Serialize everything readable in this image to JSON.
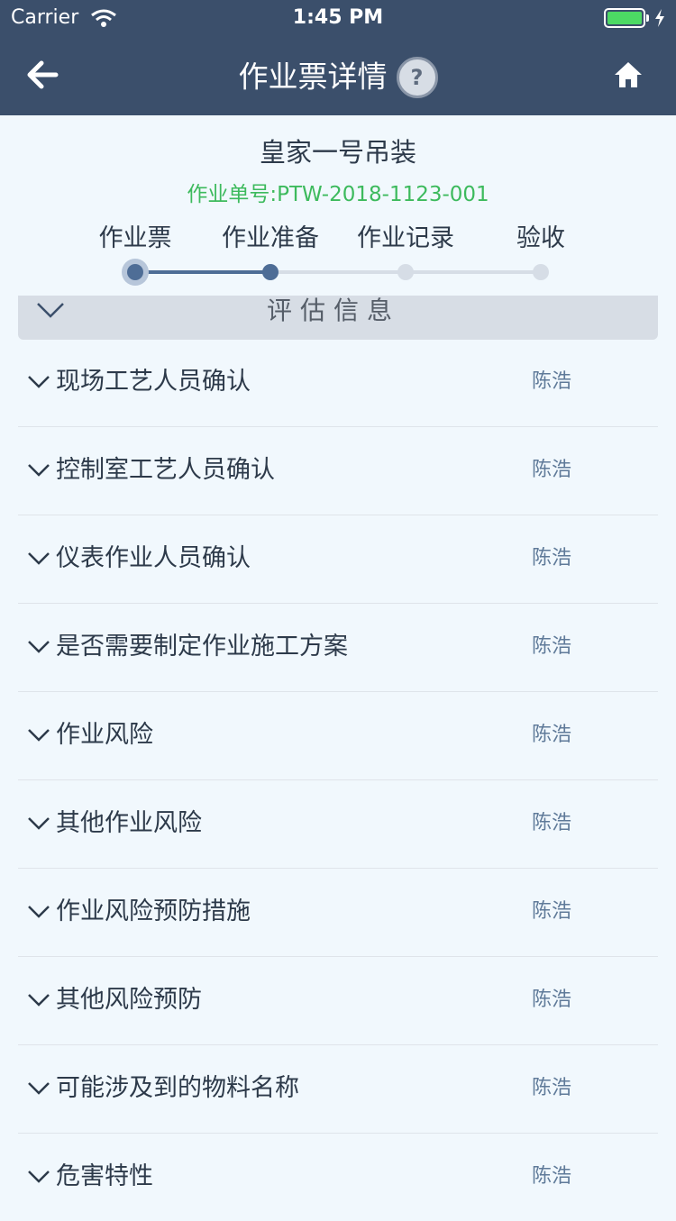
{
  "status_bar": {
    "carrier": "Carrier",
    "time": "1:45 PM"
  },
  "nav": {
    "title": "作业票详情",
    "help_symbol": "?",
    "back_icon": "arrow-left-icon",
    "home_icon": "home-icon"
  },
  "ticket": {
    "name": "皇家一号吊装",
    "number_label": "作业单号:",
    "number": "PTW-2018-1123-001"
  },
  "steps": {
    "active_index": 1,
    "items": [
      {
        "label": "作业票"
      },
      {
        "label": "作业准备"
      },
      {
        "label": "作业记录"
      },
      {
        "label": "验收"
      }
    ]
  },
  "section": {
    "title": "评估信息"
  },
  "items": [
    {
      "label": "现场工艺人员确认",
      "person": "陈浩"
    },
    {
      "label": "控制室工艺人员确认",
      "person": "陈浩"
    },
    {
      "label": "仪表作业人员确认",
      "person": "陈浩"
    },
    {
      "label": "是否需要制定作业施工方案",
      "person": "陈浩"
    },
    {
      "label": "作业风险",
      "person": "陈浩"
    },
    {
      "label": "其他作业风险",
      "person": "陈浩"
    },
    {
      "label": "作业风险预防措施",
      "person": "陈浩"
    },
    {
      "label": "其他风险预防",
      "person": "陈浩"
    },
    {
      "label": "可能涉及到的物料名称",
      "person": "陈浩"
    },
    {
      "label": "危害特性",
      "person": "陈浩"
    }
  ],
  "colors": {
    "header_bg": "#3b4f6b",
    "ticket_number": "#3dba5d",
    "step_active": "#4e6d96",
    "step_inactive": "#d6dde6",
    "person_text": "#5f7a99"
  }
}
